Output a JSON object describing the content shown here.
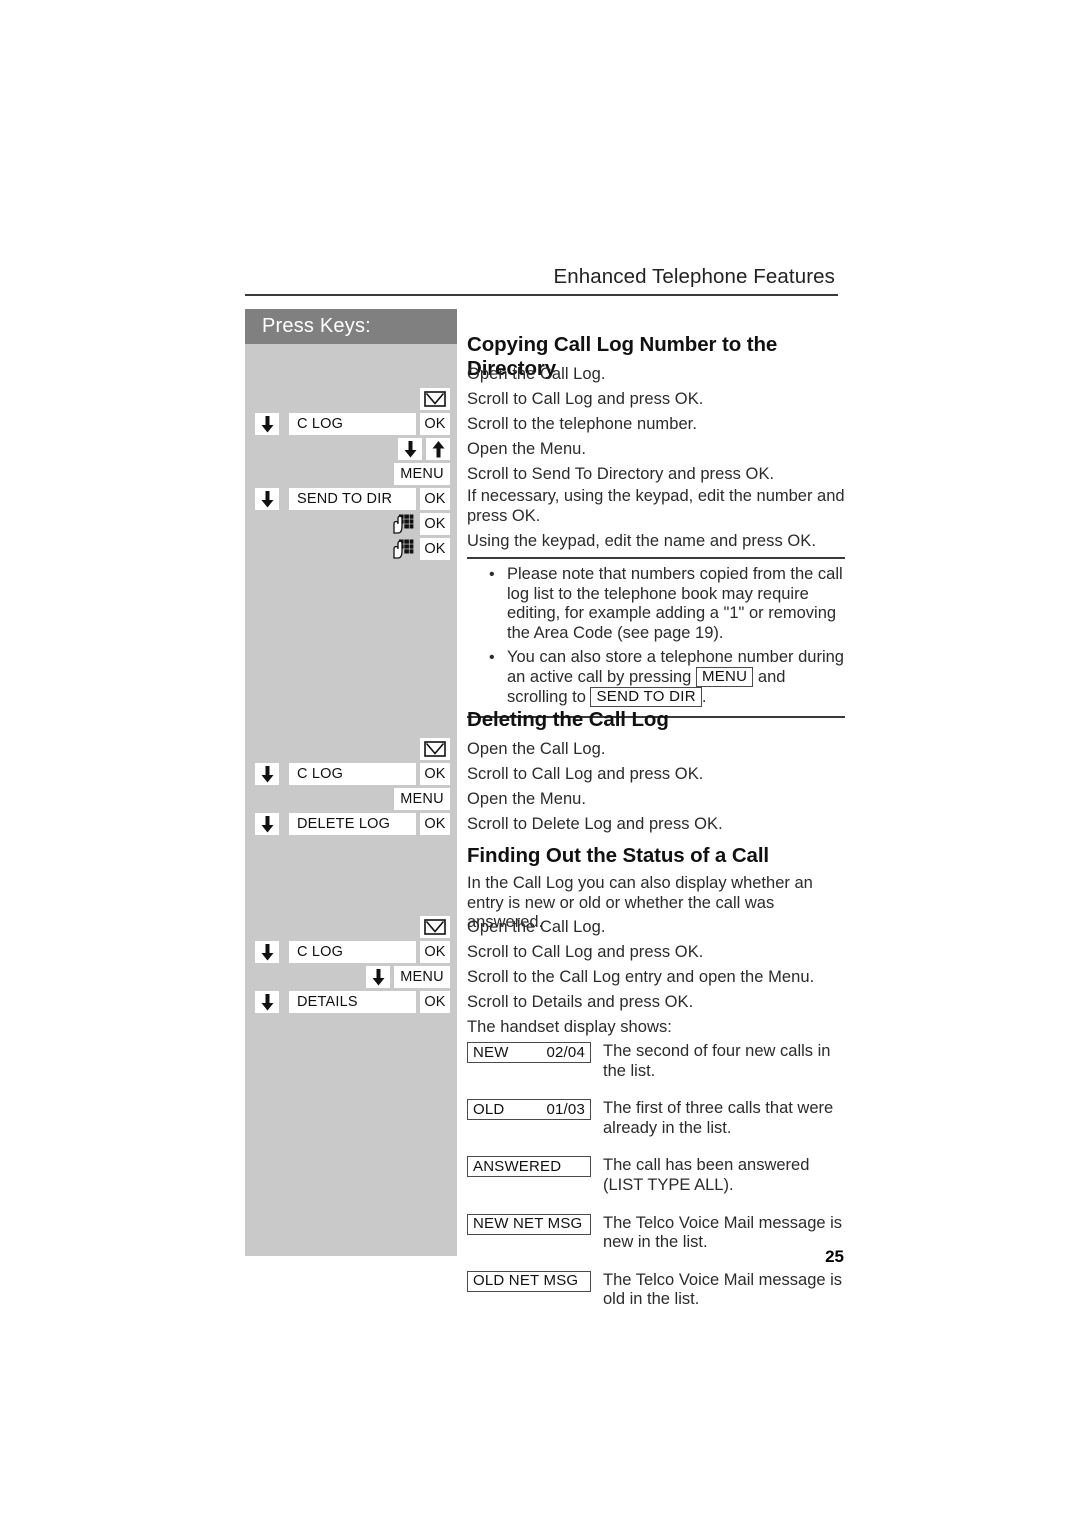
{
  "header": {
    "title": "Enhanced Telephone Features"
  },
  "sidebar": {
    "heading": "Press Keys:"
  },
  "page": {
    "number": "25"
  },
  "keys": {
    "ok": "OK",
    "menu": "MENU",
    "c_log": "C LOG",
    "send_to_dir": "SEND TO DIR",
    "delete_log": "DELETE LOG",
    "details": "DETAILS"
  },
  "icons": {
    "envelope": "envelope-icon",
    "arrow_down": "arrow-down-icon",
    "arrow_up": "arrow-up-icon",
    "keypad": "keypad-hand-icon"
  },
  "sections": [
    {
      "id": "copying",
      "title": "Copying Call Log Number to the Directory",
      "steps": [
        "Open the Call Log.",
        "Scroll to Call Log and press OK.",
        "Scroll to the telephone number.",
        "Open the Menu.",
        "Scroll to Send To Directory and press OK.",
        "If necessary, using the keypad, edit the number and press OK.",
        "Using the keypad, edit the name and press OK."
      ]
    },
    {
      "id": "deleting",
      "title": "Deleting the Call Log",
      "steps": [
        "Open the Call Log.",
        "Scroll to Call Log and press OK.",
        "Open the Menu.",
        "Scroll to Delete Log and press OK."
      ]
    },
    {
      "id": "status",
      "title": "Finding Out the Status of a Call",
      "intro": "In the Call Log you can also display whether an entry is new or old or whether the call was answered.",
      "steps": [
        "Open the Call Log.",
        "Scroll to Call Log and press OK.",
        "Scroll to the Call Log entry and open the Menu.",
        "Scroll to Details and press OK."
      ],
      "display_intro": "The handset display shows:"
    }
  ],
  "note": {
    "bullets": [
      {
        "pre": "Please note that numbers copied from the call log list to the telephone book may require editing, for example adding a \"1\" or removing the Area Code (see page 19).",
        "boxes": []
      }
    ],
    "bullet2": {
      "part1": "You can also store a telephone number during an active call by pressing",
      "box1": "MENU",
      "part2": "and scrolling to",
      "box2": "SEND TO DIR",
      "part3": "."
    }
  },
  "status_display": [
    {
      "left": "NEW",
      "right": "02/04",
      "desc": "The second of four new calls in the list."
    },
    {
      "left": "OLD",
      "right": "01/03",
      "desc": "The first of three calls that were already in the list."
    },
    {
      "left": "ANSWERED",
      "right": "",
      "desc": "The call has been answered (LIST TYPE ALL)."
    },
    {
      "left": "NEW NET MSG",
      "right": "",
      "desc": "The Telco Voice Mail message is new in the list."
    },
    {
      "left": "OLD NET MSG",
      "right": "",
      "desc": "The Telco Voice Mail message is old in the list."
    }
  ]
}
